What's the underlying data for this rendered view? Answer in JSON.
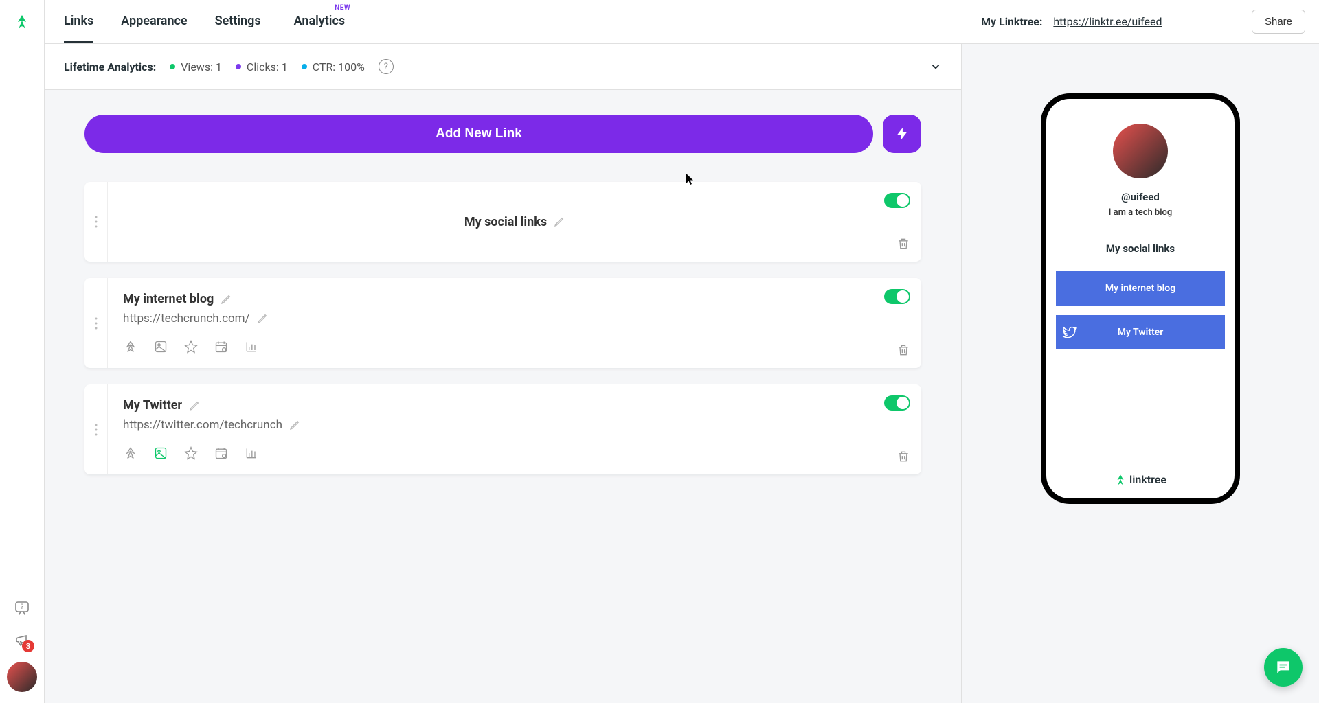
{
  "brand": "linktree",
  "tabs": {
    "links": "Links",
    "appearance": "Appearance",
    "settings": "Settings",
    "analytics": "Analytics",
    "badge_new": "NEW"
  },
  "analytics": {
    "label": "Lifetime Analytics:",
    "views": "Views: 1",
    "clicks": "Clicks: 1",
    "ctr": "CTR: 100%"
  },
  "add_button": "Add New Link",
  "header_card": {
    "title": "My social links"
  },
  "links": [
    {
      "title": "My internet blog",
      "url": "https://techcrunch.com/",
      "image_active": false
    },
    {
      "title": "My Twitter",
      "url": "https://twitter.com/techcrunch",
      "image_active": true
    }
  ],
  "sidebar": {
    "notification_count": "3"
  },
  "topbar": {
    "label": "My Linktree:",
    "url": "https://linktr.ee/uifeed",
    "share": "Share"
  },
  "preview": {
    "handle": "@uifeed",
    "bio": "I am a tech blog",
    "section": "My social links",
    "link1": "My internet blog",
    "link2": "My Twitter",
    "footer": "linktree"
  }
}
